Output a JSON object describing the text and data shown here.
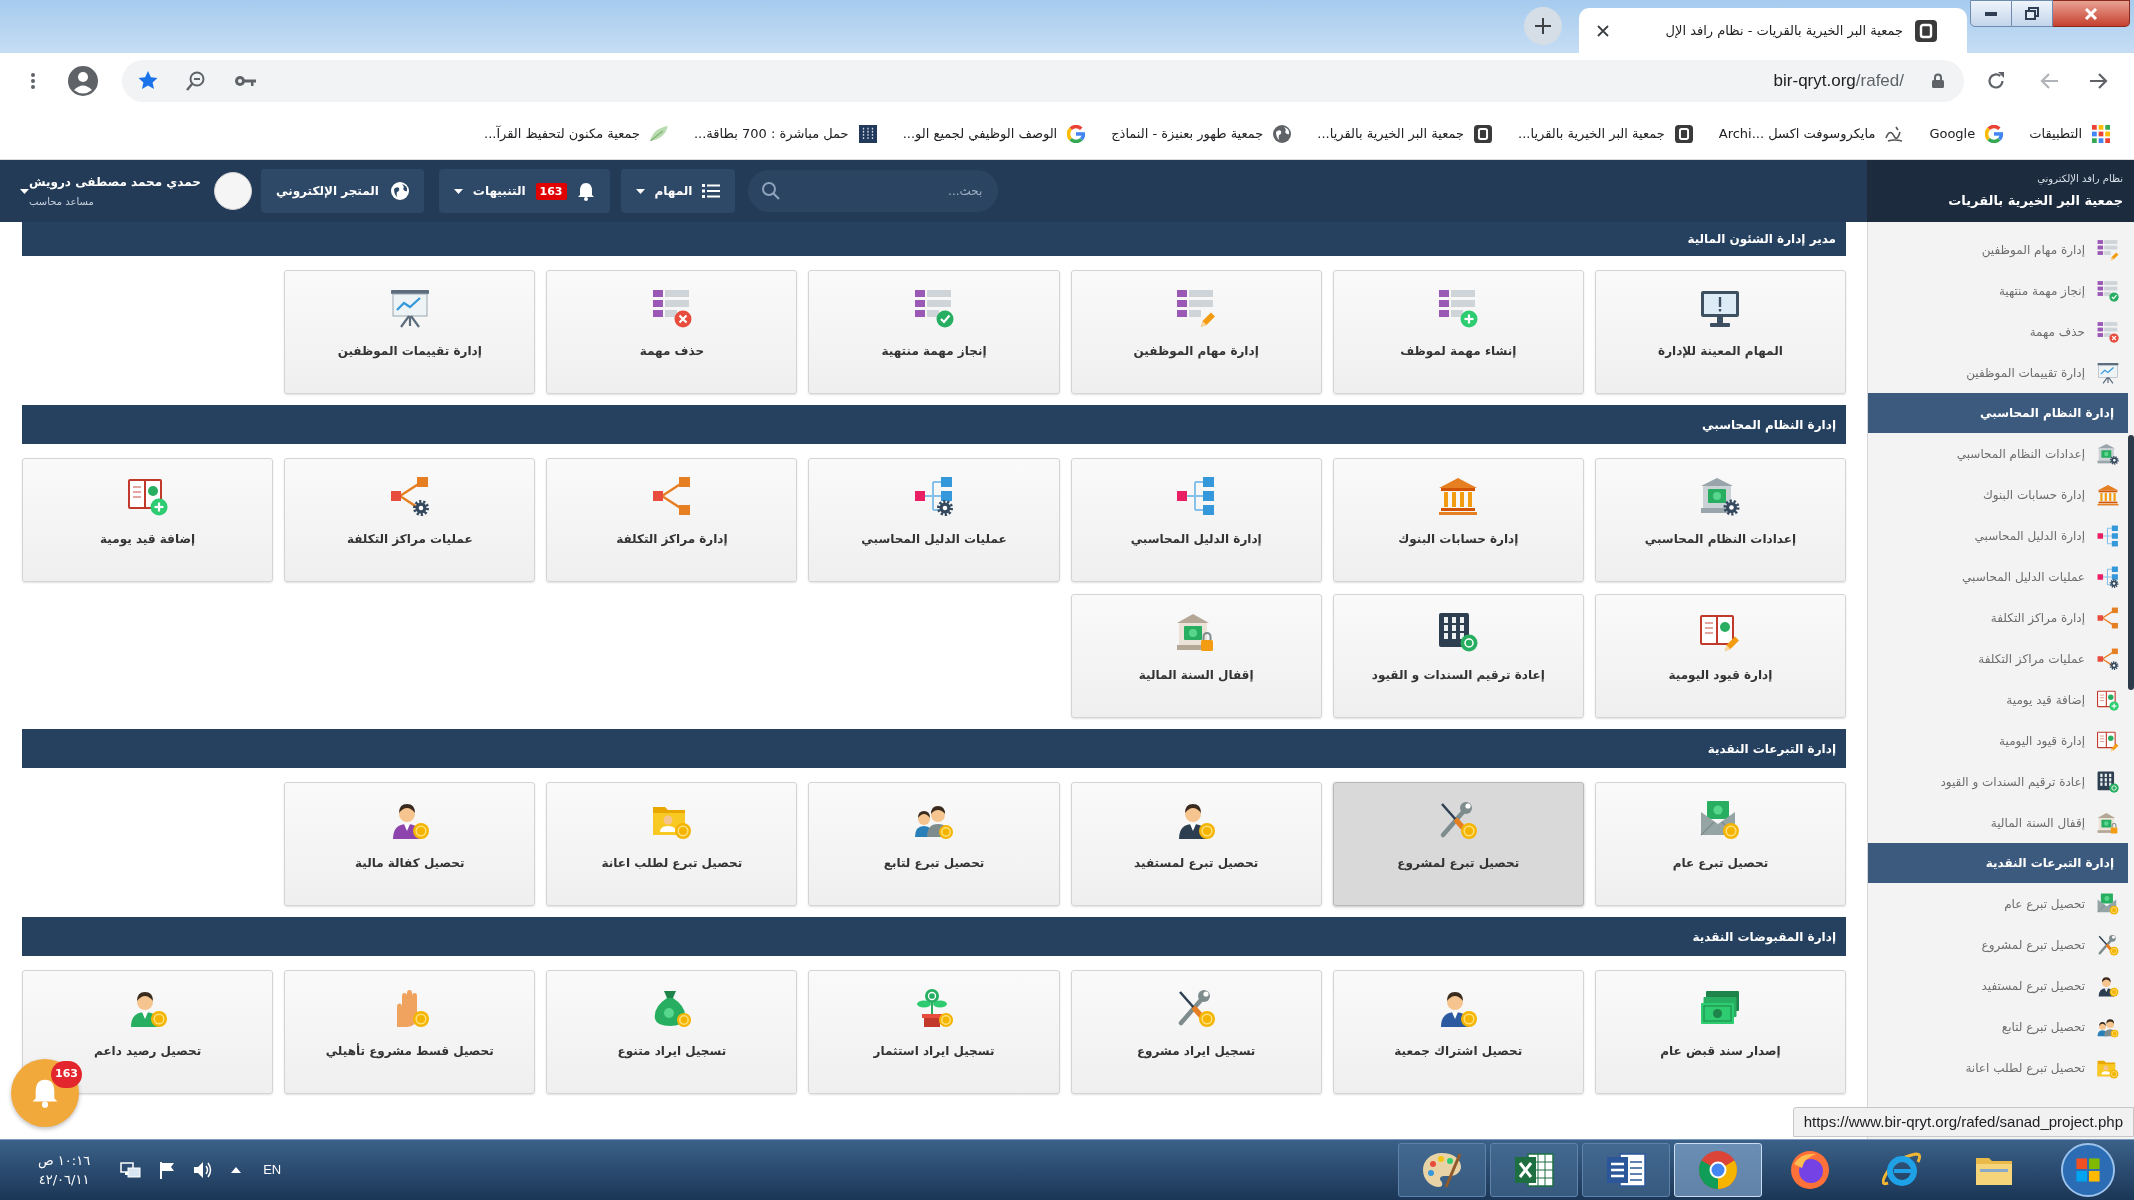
{
  "browser": {
    "tab_title": "جمعية البر الخيرية بالقريات - نظام رافد الإل",
    "url": {
      "host": "bir-qryt.org",
      "path": "/rafed/"
    },
    "bookmarks": [
      {
        "label": "التطبيقات"
      },
      {
        "label": "Google"
      },
      {
        "label": "مايكروسوفت اكسل ...Archi"
      },
      {
        "label": "جمعية البر الخيرية بالقريا..."
      },
      {
        "label": "جمعية البر الخيرية بالقريا..."
      },
      {
        "label": "جمعية طهور بعنيزة - النماذج"
      },
      {
        "label": "الوصف الوظيفي لجميع الو..."
      },
      {
        "label": "حمل مباشرة : 700 بطاقة..."
      },
      {
        "label": "جمعية مكنون لتحفيظ القرآ..."
      }
    ],
    "status_url": "https://www.bir-qryt.org/rafed/sanad_project.php"
  },
  "header": {
    "app_subtitle": "نظام رافد الإلكتروني",
    "org_name": "جمعية البر الخيرية بالقريات",
    "search": {
      "placeholder": "بحث..."
    },
    "tasks_menu": {
      "label": "المهام"
    },
    "alerts_menu": {
      "label": "التنبيهات",
      "count": "163"
    },
    "store_button": {
      "label": "المتجر الإلكتروني"
    },
    "user": {
      "name": "حمدي محمد مصطفى درويش",
      "role": "مساعد محاسب"
    }
  },
  "sections": [
    {
      "title": "مدير إدارة الشئون المالية",
      "tiles": [
        {
          "label": "المهام المعينة للإدارة",
          "hovered": false
        },
        {
          "label": "إنشاء مهمة لموظف",
          "hovered": false
        },
        {
          "label": "إدارة مهام الموظفين",
          "hovered": false
        },
        {
          "label": "إنجاز مهمة منتهية",
          "hovered": false
        },
        {
          "label": "حذف مهمة",
          "hovered": false
        },
        {
          "label": "إدارة تقييمات الموظفين",
          "hovered": false
        }
      ]
    },
    {
      "title": "إدارة النظام المحاسبي",
      "tiles": [
        {
          "label": "إعدادات النظام المحاسبي",
          "hovered": false
        },
        {
          "label": "إدارة حسابات البنوك",
          "hovered": false
        },
        {
          "label": "إدارة الدليل المحاسبي",
          "hovered": false
        },
        {
          "label": "عمليات الدليل المحاسبي",
          "hovered": false
        },
        {
          "label": "إدارة مراكز التكلفة",
          "hovered": false
        },
        {
          "label": "عمليات مراكز التكلفة",
          "hovered": false
        },
        {
          "label": "إضافة قيد يومية",
          "hovered": false
        },
        {
          "label": "إدارة قيود اليومية",
          "hovered": false
        },
        {
          "label": "إعادة ترقيم السندات و القيود",
          "hovered": false
        },
        {
          "label": "إقفال السنة المالية",
          "hovered": false
        }
      ]
    },
    {
      "title": "إدارة التبرعات النقدية",
      "tiles": [
        {
          "label": "تحصيل تبرع عام",
          "hovered": false
        },
        {
          "label": "تحصيل تبرع لمشروع",
          "hovered": true
        },
        {
          "label": "تحصيل تبرع لمستفيد",
          "hovered": false
        },
        {
          "label": "تحصيل تبرع لتابع",
          "hovered": false
        },
        {
          "label": "تحصيل تبرع لطلب اعانة",
          "hovered": false
        },
        {
          "label": "تحصيل كفالة مالية",
          "hovered": false
        }
      ]
    },
    {
      "title": "إدارة المقبوضات النقدية",
      "tiles": [
        {
          "label": "إصدار سند قبض عام",
          "hovered": false
        },
        {
          "label": "تحصيل اشتراك جمعية",
          "hovered": false
        },
        {
          "label": "تسجيل ايراد مشروع",
          "hovered": false
        },
        {
          "label": "تسجيل ايراد استثمار",
          "hovered": false
        },
        {
          "label": "تسجيل ايراد متنوع",
          "hovered": false
        },
        {
          "label": "تحصيل قسط مشروع تأهيلي",
          "hovered": false
        },
        {
          "label": "تحصيل رصيد داعم",
          "hovered": false
        }
      ]
    }
  ],
  "sidebar": {
    "groups": [
      {
        "items": [
          {
            "label": "إدارة مهام الموظفين"
          },
          {
            "label": "إنجاز مهمة منتهية"
          },
          {
            "label": "حذف مهمة"
          },
          {
            "label": "إدارة تقييمات الموظفين"
          }
        ]
      },
      {
        "title": "إدارة النظام المحاسبي",
        "items": [
          {
            "label": "إعدادات النظام المحاسبي"
          },
          {
            "label": "إدارة حسابات البنوك"
          },
          {
            "label": "إدارة الدليل المحاسبي"
          },
          {
            "label": "عمليات الدليل المحاسبي"
          },
          {
            "label": "إدارة مراكز التكلفة"
          },
          {
            "label": "عمليات مراكز التكلفة"
          },
          {
            "label": "إضافة قيد يومية"
          },
          {
            "label": "إدارة قيود اليومية"
          },
          {
            "label": "إعادة ترقيم السندات و القيود"
          },
          {
            "label": "إقفال السنة المالية"
          }
        ]
      },
      {
        "title": "إدارة التبرعات النقدية",
        "items": [
          {
            "label": "تحصيل تبرع عام"
          },
          {
            "label": "تحصيل تبرع لمشروع"
          },
          {
            "label": "تحصيل تبرع لمستفيد"
          },
          {
            "label": "تحصيل تبرع لتابع"
          },
          {
            "label": "تحصيل تبرع لطلب اعانة"
          }
        ]
      }
    ]
  },
  "floating_alerts": {
    "count": "163"
  },
  "taskbar": {
    "time": "١٠:١٦ ص",
    "date": "٤٢/٠٦/١١",
    "language": "EN",
    "apps": [
      {
        "running": true,
        "selected": false
      },
      {
        "running": true,
        "selected": false
      },
      {
        "running": true,
        "selected": false
      },
      {
        "running": true,
        "selected": true
      },
      {
        "running": false,
        "selected": false
      },
      {
        "running": false,
        "selected": false
      },
      {
        "running": false,
        "selected": false
      }
    ]
  }
}
